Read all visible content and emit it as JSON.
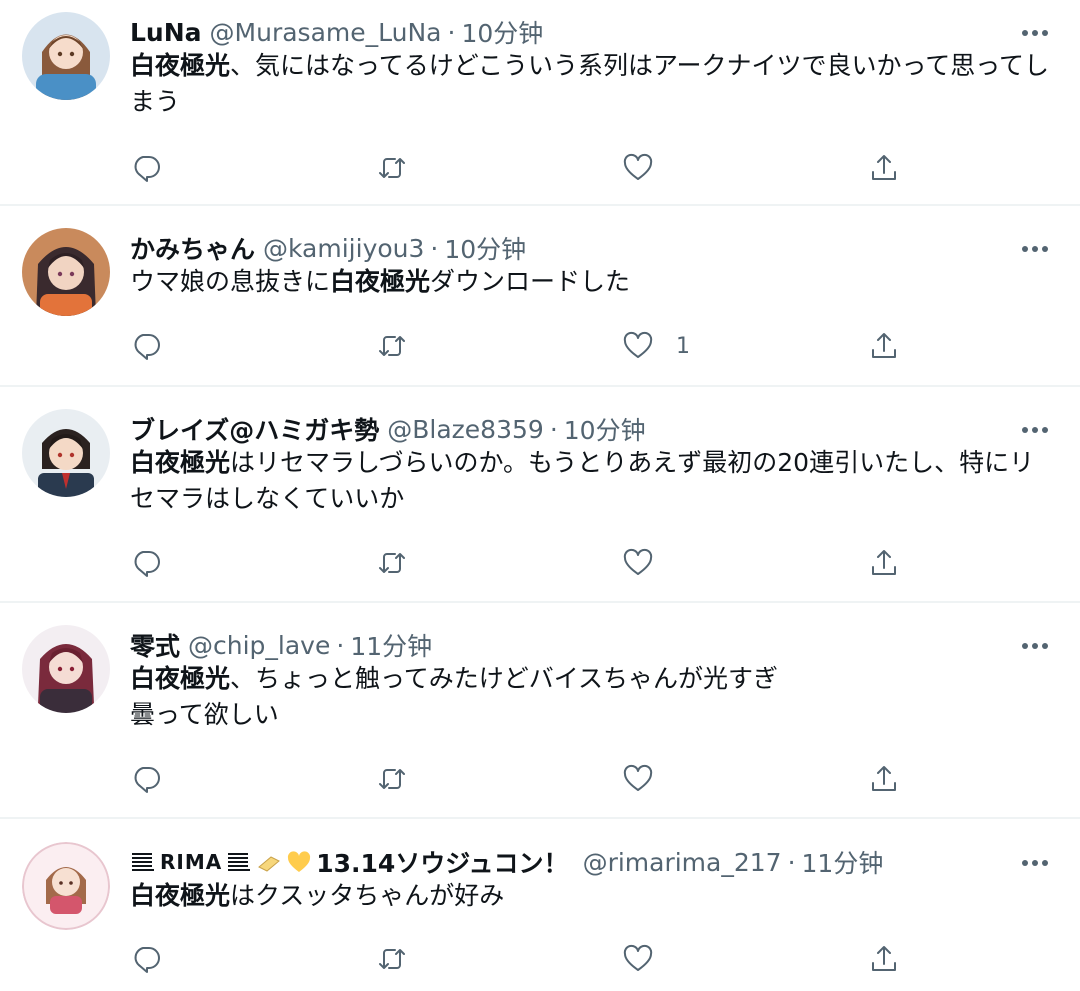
{
  "tweets": [
    {
      "name": "LuNa",
      "handle": "@Murasame_LuNa",
      "separator": "·",
      "time": "10分钟",
      "keyword": "白夜極光",
      "text": "、気にはなってるけどこういう系列はアークナイツで良いかって思ってしまう",
      "likes": "",
      "avatar": "anime-girl-brown-hair-avatar"
    },
    {
      "name": "かみちゃん",
      "handle": "@kamijiyou3",
      "separator": "·",
      "time": "10分钟",
      "prefix": "ウマ娘の息抜きに",
      "keyword": "白夜極光",
      "text": "ダウンロードした",
      "likes": "1",
      "avatar": "anime-girl-dark-hair-avatar"
    },
    {
      "name": "ブレイズ@ハミガキ勢",
      "handle": "@Blaze8359",
      "separator": "·",
      "time": "10分钟",
      "keyword": "白夜極光",
      "text": "はリセマラしづらいのか。もうとりあえず最初の20連引いたし、特にリセマラはしなくていいか",
      "likes": "",
      "avatar": "anime-boy-uniform-avatar"
    },
    {
      "name": "零式",
      "handle": "@chip_lave",
      "separator": "·",
      "time": "11分钟",
      "keyword": "白夜極光",
      "text_line1": "、ちょっと触ってみたけどバイスちゃんが光すぎ",
      "text_line2": "曇って欲しい",
      "likes": "",
      "avatar": "anime-girl-red-hair-avatar"
    },
    {
      "name_part1": "RIMA",
      "name_part2": "13.14ソウジュコン！",
      "handle": "@rimarima_217",
      "separator": "·",
      "time": "11分钟",
      "keyword": "白夜極光",
      "text": "はクスッタちゃんが好み",
      "likes": "",
      "avatar": "chibi-girl-pink-avatar"
    }
  ],
  "icons": {
    "reply": "reply-icon",
    "retweet": "retweet-icon",
    "like": "heart-icon",
    "share": "share-icon",
    "more": "more-icon"
  },
  "colors": {
    "text": "#0f1419",
    "secondary": "#536471",
    "divider": "#eff3f4",
    "heart_emoji": "#ffcc4d"
  }
}
